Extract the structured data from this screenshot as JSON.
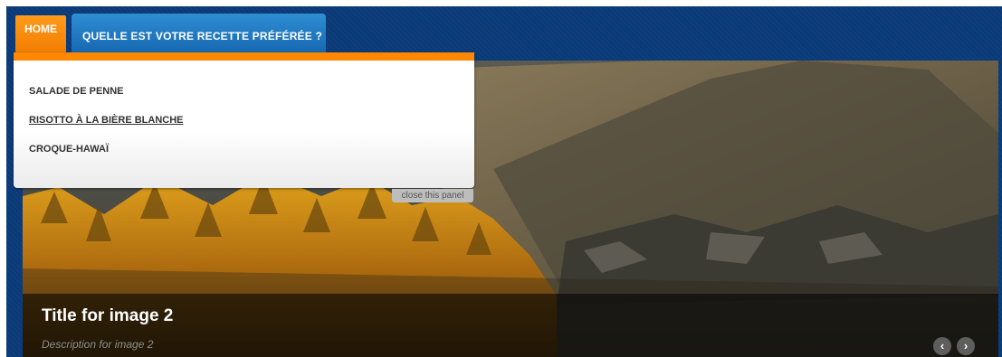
{
  "nav": {
    "home_label": "HOME",
    "tab_label": "QUELLE EST VOTRE RECETTE PRÉFÉRÉE ?"
  },
  "dropdown": {
    "items": [
      {
        "label": "SALADE DE PENNE"
      },
      {
        "label": "RISOTTO À LA BIÈRE BLANCHE"
      },
      {
        "label": "CROQUE-HAWAÏ"
      }
    ],
    "close_label": "close this panel"
  },
  "slide": {
    "title": "Title for image 2",
    "description": "Description for image 2"
  },
  "controls": {
    "prev_icon": "‹",
    "next_icon": "›"
  },
  "colors": {
    "nav_bg": "#0b3a78",
    "home_tab": "#f07a00",
    "active_tab": "#1a6fb7",
    "dropdown_accent": "#ff8800"
  }
}
